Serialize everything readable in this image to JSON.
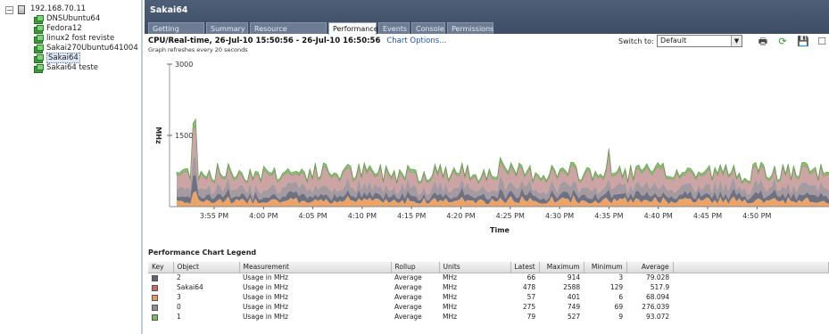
{
  "tree": {
    "host": "192.168.70.11",
    "vms": [
      "DNSUbuntu64",
      "Fedora12",
      "linux2 fost reviste",
      "Sakai270Ubuntu641004",
      "Sakai64",
      "Sakai64 teste"
    ],
    "selected_index": 4
  },
  "vm_title": "Sakai64",
  "tabs": [
    {
      "label": "Getting Started",
      "active": false
    },
    {
      "label": "Summary",
      "active": false
    },
    {
      "label": "Resource Allocation",
      "active": false
    },
    {
      "label": "Performance",
      "active": true
    },
    {
      "label": "Events",
      "active": false
    },
    {
      "label": "Console",
      "active": false
    },
    {
      "label": "Permissions",
      "active": false
    }
  ],
  "performance": {
    "title": "CPU/Real-time, 26-Jul-10 15:50:56 - 26-Jul-10 16:50:56",
    "chart_options_link": "Chart Options...",
    "refresh_note": "Graph refreshes every 20 seconds",
    "switch_to_label": "Switch to:",
    "switch_to_value": "Default"
  },
  "toolbar_icons": [
    "print-icon",
    "refresh-icon",
    "save-icon",
    "popout-icon"
  ],
  "chart_data": {
    "type": "area",
    "ylabel": "MHz",
    "xlabel": "Time",
    "y_ticks": [
      "3000",
      "1500"
    ],
    "ylim": [
      0,
      3000
    ],
    "x_tick_labels": [
      "3:55 PM",
      "4:00 PM",
      "4:05 PM",
      "4:10 PM",
      "4:15 PM",
      "4:20 PM",
      "4:25 PM",
      "4:30 PM",
      "4:35 PM",
      "4:40 PM",
      "4:45 PM",
      "4:50 PM"
    ],
    "stacking": "stacked",
    "series": [
      {
        "name": "Sakai64",
        "color": "#c76a6a",
        "average": 517.9,
        "min": 129,
        "max": 2588
      },
      {
        "name": "0",
        "color": "#8f8f8f",
        "average": 276.039,
        "min": 69,
        "max": 749
      },
      {
        "name": "1",
        "color": "#7db863",
        "average": 93.072,
        "min": 9,
        "max": 527
      },
      {
        "name": "2",
        "color": "#5e6273",
        "average": 79.028,
        "min": 3,
        "max": 914
      },
      {
        "name": "3",
        "color": "#e89a5a",
        "average": 68.094,
        "min": 6,
        "max": 401
      }
    ],
    "envelope_peaks": [
      {
        "time": "3:53 PM",
        "value": 2588
      },
      {
        "time": "4:06 PM",
        "value": 1100
      },
      {
        "time": "4:15 PM",
        "value": 1050
      },
      {
        "time": "4:18 PM",
        "value": 1100
      },
      {
        "time": "4:24 PM",
        "value": 1100
      },
      {
        "time": "4:35 PM",
        "value": 1250
      }
    ]
  },
  "legend": {
    "title": "Performance Chart Legend",
    "columns": [
      "Key",
      "Object",
      "Measurement",
      "Rollup",
      "Units",
      "Latest",
      "Maximum",
      "Minimum",
      "Average"
    ],
    "rows": [
      {
        "color": "#5e6273",
        "object": "2",
        "measurement": "Usage in MHz",
        "rollup": "Average",
        "units": "MHz",
        "latest": "66",
        "maximum": "914",
        "minimum": "3",
        "average": "79.028"
      },
      {
        "color": "#c76a6a",
        "object": "Sakai64",
        "measurement": "Usage in MHz",
        "rollup": "Average",
        "units": "MHz",
        "latest": "478",
        "maximum": "2588",
        "minimum": "129",
        "average": "517.9"
      },
      {
        "color": "#e89a5a",
        "object": "3",
        "measurement": "Usage in MHz",
        "rollup": "Average",
        "units": "MHz",
        "latest": "57",
        "maximum": "401",
        "minimum": "6",
        "average": "68.094"
      },
      {
        "color": "#8f8f8f",
        "object": "0",
        "measurement": "Usage in MHz",
        "rollup": "Average",
        "units": "MHz",
        "latest": "275",
        "maximum": "749",
        "minimum": "69",
        "average": "276.039"
      },
      {
        "color": "#7db863",
        "object": "1",
        "measurement": "Usage in MHz",
        "rollup": "Average",
        "units": "MHz",
        "latest": "79",
        "maximum": "527",
        "minimum": "9",
        "average": "93.072"
      }
    ]
  }
}
